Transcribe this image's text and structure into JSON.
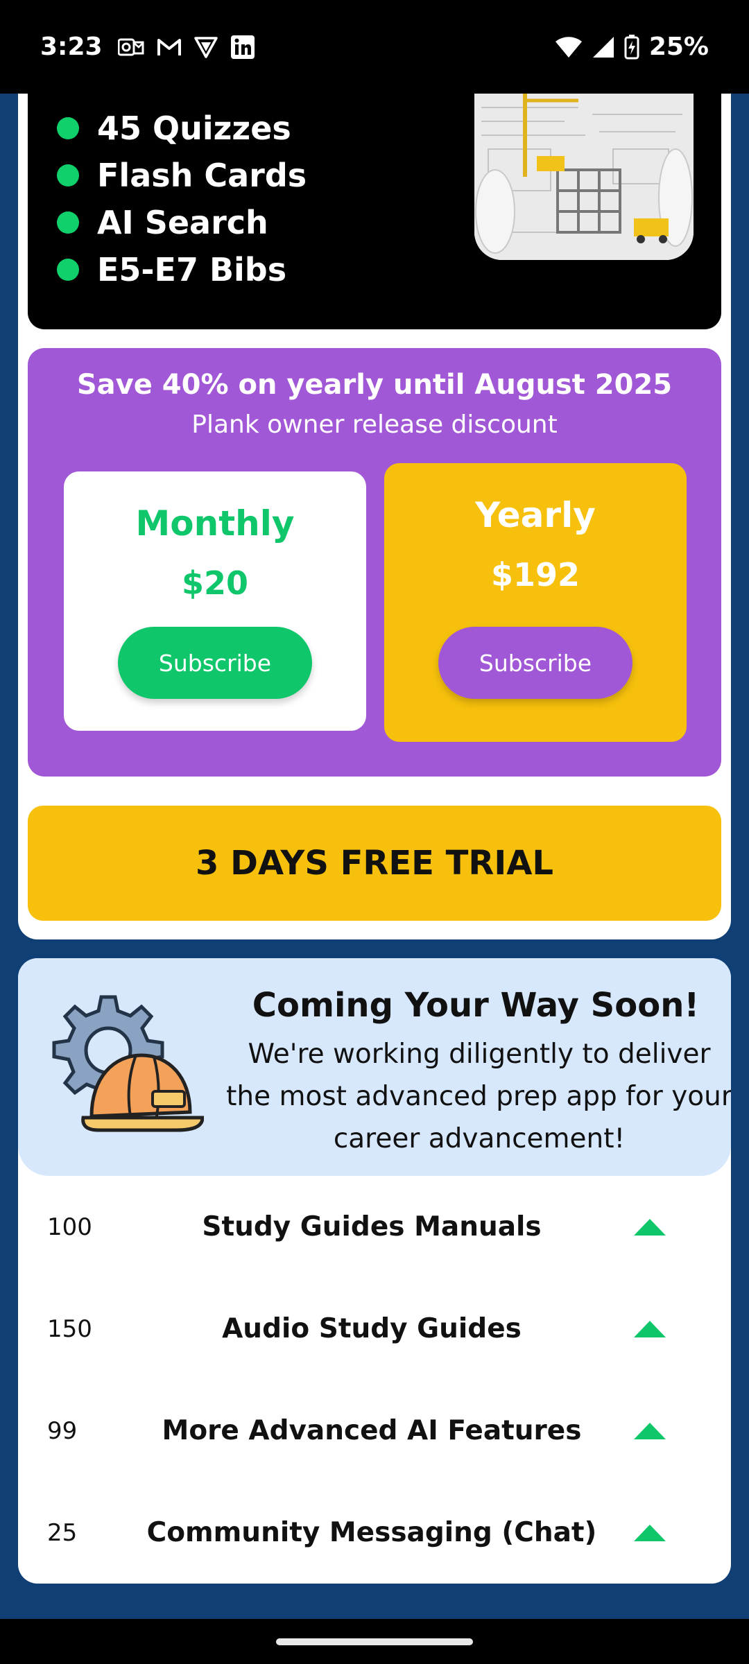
{
  "status_bar": {
    "time": "3:23",
    "battery": "25%",
    "notification_icons": [
      "outlook-icon",
      "gmail-icon",
      "proton-vpn-icon",
      "linkedin-icon"
    ],
    "system_icons": [
      "wifi-icon",
      "signal-icon",
      "battery-charging-icon"
    ]
  },
  "features": {
    "items": [
      "45 Quizzes",
      "Flash Cards",
      "AI Search",
      "E5-E7 Bibs"
    ],
    "bullet_color": "#0fd06b"
  },
  "promo": {
    "title": "Save 40% on yearly until August 2025",
    "subtitle": "Plank owner release discount"
  },
  "plans": {
    "monthly": {
      "name": "Monthly",
      "price": "$20",
      "button": "Subscribe",
      "color": "#0fc76a"
    },
    "yearly": {
      "name": "Yearly",
      "price": "$192",
      "button": "Subscribe",
      "color": "#f6c00c"
    }
  },
  "trial": {
    "label": "3 DAYS FREE TRIAL"
  },
  "coming_soon": {
    "title": "Coming Your Way Soon!",
    "text": "We're working diligently to deliver the most advanced prep app for your career advancement!",
    "items": [
      {
        "count": "100",
        "title": "Study Guides Manuals"
      },
      {
        "count": "150",
        "title": "Audio Study Guides"
      },
      {
        "count": "99",
        "title": "More Advanced AI Features"
      },
      {
        "count": "25",
        "title": "Community Messaging (Chat)"
      }
    ]
  },
  "colors": {
    "background": "#0f3f75",
    "purple": "#a158d6",
    "yellow": "#f6c00c",
    "green": "#0fc76a",
    "light_blue": "#d7e8fd"
  }
}
